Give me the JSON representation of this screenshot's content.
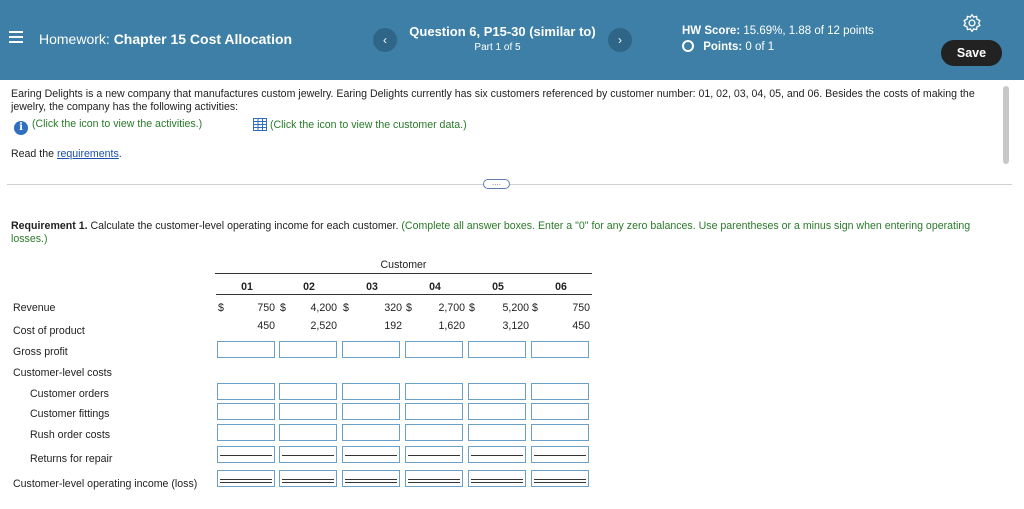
{
  "header": {
    "course_label": "Homework:",
    "assignment": "Chapter 15 Cost Allocation",
    "question_title": "Question 6, P15-30 (similar to)",
    "question_part": "Part 1 of 5",
    "hw_score_label": "HW Score:",
    "hw_score_value": "15.69%, 1.88 of 12 points",
    "points_label": "Points:",
    "points_value": "0 of 1",
    "save_label": "Save",
    "prev_arrow": "‹",
    "next_arrow": "›"
  },
  "body": {
    "intro": "Earing Delights is a new company that manufactures custom jewelry. Earing Delights currently has six customers referenced by customer number: 01, 02, 03, 04, 05, and 06. Besides the costs of making the jewelry, the company has the following activities:",
    "activities_link": "(Click the icon to view the activities.)",
    "customer_link": "(Click the icon to view the customer data.)",
    "read_prefix": "Read the ",
    "requirements_link": "requirements",
    "read_suffix": ".",
    "more_label": "....",
    "req_bold": "Requirement 1.",
    "req_text": " Calculate the customer-level operating income for each customer. ",
    "req_green": "(Complete all answer boxes. Enter a \"0\" for any zero balances. Use parentheses or a minus sign when entering operating losses.)"
  },
  "table": {
    "group_header": "Customer",
    "columns": [
      "01",
      "02",
      "03",
      "04",
      "05",
      "06"
    ],
    "currency": "$",
    "rows": {
      "revenue_label": "Revenue",
      "cost_label": "Cost of product",
      "gross_label": "Gross profit",
      "customer_costs_label": "Customer-level costs",
      "orders_label": "Customer orders",
      "fittings_label": "Customer fittings",
      "rush_label": "Rush order costs",
      "returns_label": "Returns for repair",
      "income_label": "Customer-level operating income (loss)"
    },
    "revenue": [
      "750",
      "4,200",
      "320",
      "2,700",
      "5,200",
      "750"
    ],
    "cost": [
      "450",
      "2,520",
      "192",
      "1,620",
      "3,120",
      "450"
    ]
  }
}
